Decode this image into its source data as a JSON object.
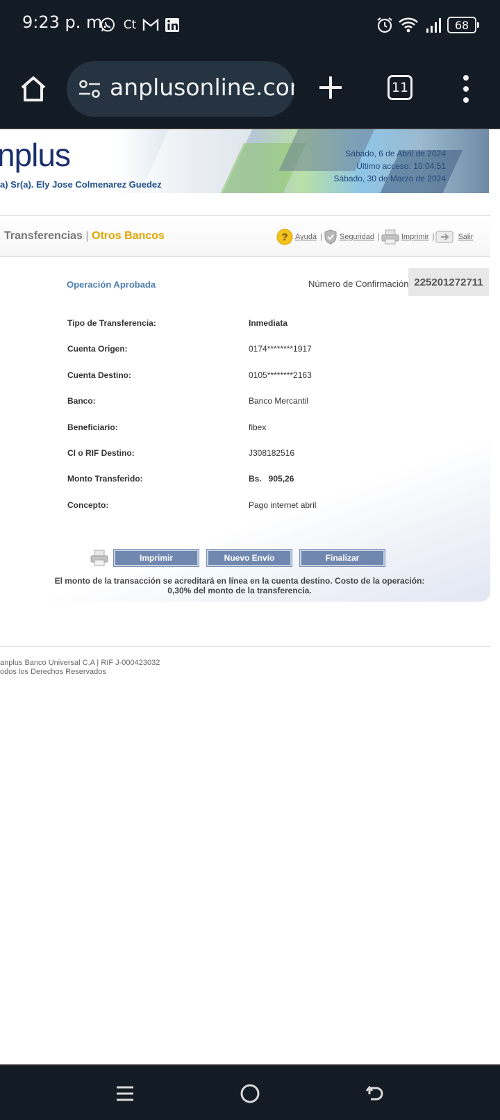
{
  "status_bar": {
    "time": "9:23 p. m.",
    "battery": "68",
    "left_icons": [
      "whatsapp-icon",
      "ct-icon",
      "gmail-icon",
      "linkedin-icon"
    ],
    "right_icons": [
      "alarm-icon",
      "wifi-icon",
      "signal-icon",
      "battery-icon"
    ]
  },
  "browser": {
    "url": "anplusonline.com",
    "tab_count": "11"
  },
  "banner": {
    "logo": "nplus",
    "user_greeting": "a) Sr(a). Ely Jose Colmenarez Guedez",
    "current_date": "Sábado, 6 de Abril de 2024",
    "last_access": "Último acceso: 10:04:51",
    "last_access_date": "Sábado, 30 de Marzo de 2024"
  },
  "nav": {
    "section": "Transferencias",
    "separator": "|",
    "subsection": "Otros Bancos",
    "links": {
      "help": "Ayuda",
      "security": "Seguridad",
      "print": "Imprimir",
      "exit": "Salir"
    }
  },
  "operation": {
    "status": "Operación Aprobada",
    "confirmation_label": "Número de Confirmación:",
    "confirmation_number": "225201272711"
  },
  "details": [
    {
      "label": "Tipo de Transferencia:",
      "value": "Inmediata"
    },
    {
      "label": "Cuenta Origen:",
      "value": "0174********1917"
    },
    {
      "label": "Cuenta Destino:",
      "value": "0105********2163"
    },
    {
      "label": "Banco:",
      "value": "Banco Mercantil"
    },
    {
      "label": "Beneficiario:",
      "value": "fibex"
    },
    {
      "label": "CI o RIF Destino:",
      "value": "J308182516"
    },
    {
      "label": "Monto Transferido:",
      "value": "Bs.   905,26"
    },
    {
      "label": "Concepto:",
      "value": "Pago internet abril"
    }
  ],
  "buttons": {
    "print": "Imprimir",
    "new_send": "Nuevo Envío",
    "finish": "Finalizar"
  },
  "note": "El monto de la transacción se acreditará en línea en la cuenta destino. Costo de la operación: 0,30% del monto de la transferencia.",
  "footer": {
    "line1": "anplus Banco Universal C.A | RIF J-000423032",
    "line2": "odos los Derechos Reservados"
  },
  "colors": {
    "chrome": "#131b25",
    "accent_gold": "#e0a500",
    "status_blue": "#4e7fb0",
    "button_blue": "#7088b0"
  }
}
